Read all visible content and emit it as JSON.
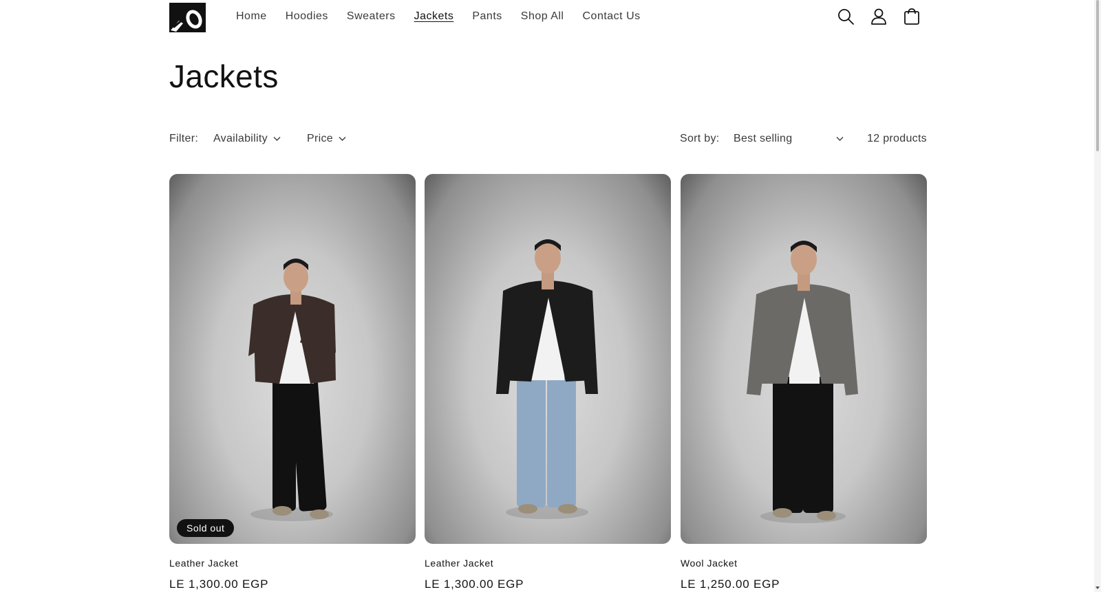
{
  "header": {
    "logo_icon": "brand-logo-icon",
    "nav": [
      {
        "label": "Home",
        "active": false
      },
      {
        "label": "Hoodies",
        "active": false
      },
      {
        "label": "Sweaters",
        "active": false
      },
      {
        "label": "Jackets",
        "active": true
      },
      {
        "label": "Pants",
        "active": false
      },
      {
        "label": "Shop All",
        "active": false
      },
      {
        "label": "Contact Us",
        "active": false
      }
    ],
    "icons": [
      "search-icon",
      "account-icon",
      "cart-icon"
    ]
  },
  "page": {
    "title": "Jackets"
  },
  "filters": {
    "label": "Filter:",
    "availability": "Availability",
    "price": "Price",
    "sort_label": "Sort by:",
    "sort_value": "Best selling",
    "count": "12 products"
  },
  "products": [
    {
      "title": "Leather Jacket",
      "price": "LE 1,300.00 EGP",
      "badge": "Sold out",
      "jacket_color": "#3b2e2a",
      "pants_color": "#111111"
    },
    {
      "title": "Leather Jacket",
      "price": "LE 1,300.00 EGP",
      "badge": "",
      "jacket_color": "#1c1c1c",
      "pants_color": "#8fa9c4"
    },
    {
      "title": "Wool Jacket",
      "price": "LE 1,250.00 EGP",
      "badge": "",
      "jacket_color": "#6b6a66",
      "pants_color": "#121212"
    }
  ]
}
